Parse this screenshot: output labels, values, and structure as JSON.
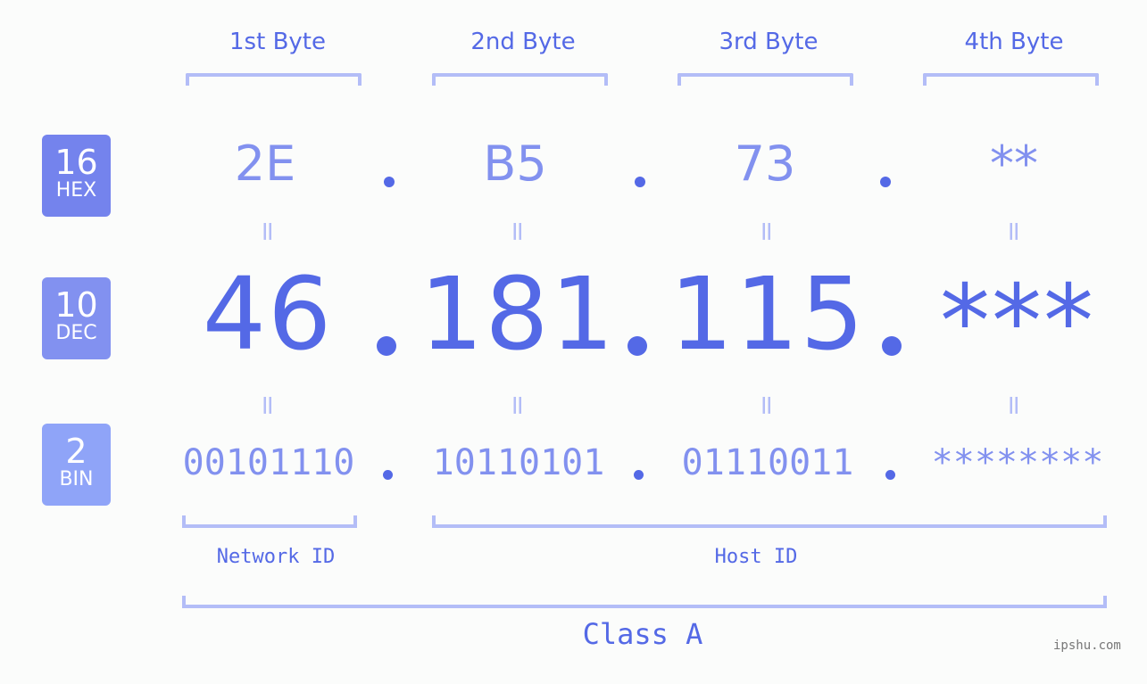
{
  "colors": {
    "primary": "#5469e6",
    "light": "#8291ef",
    "bracket": "#b3bdf7",
    "hex_badge": "#7483ed",
    "dec_badge": "#8291f0",
    "bin_badge": "#8fa4f8",
    "watermark": "#777777"
  },
  "byte_headers": [
    "1st Byte",
    "2nd Byte",
    "3rd Byte",
    "4th Byte"
  ],
  "badges": {
    "hex": {
      "number": "16",
      "label": "HEX"
    },
    "dec": {
      "number": "10",
      "label": "DEC"
    },
    "bin": {
      "number": "2",
      "label": "BIN"
    }
  },
  "hex_values": [
    "2E",
    "B5",
    "73",
    "**"
  ],
  "dec_values": [
    "46",
    "181",
    "115",
    "***"
  ],
  "bin_values": [
    "00101110",
    "10110101",
    "01110011",
    "********"
  ],
  "equals_symbol": "=",
  "separator": ".",
  "network_id_label": "Network ID",
  "host_id_label": "Host ID",
  "class_label": "Class A",
  "watermark": "ipshu.com"
}
